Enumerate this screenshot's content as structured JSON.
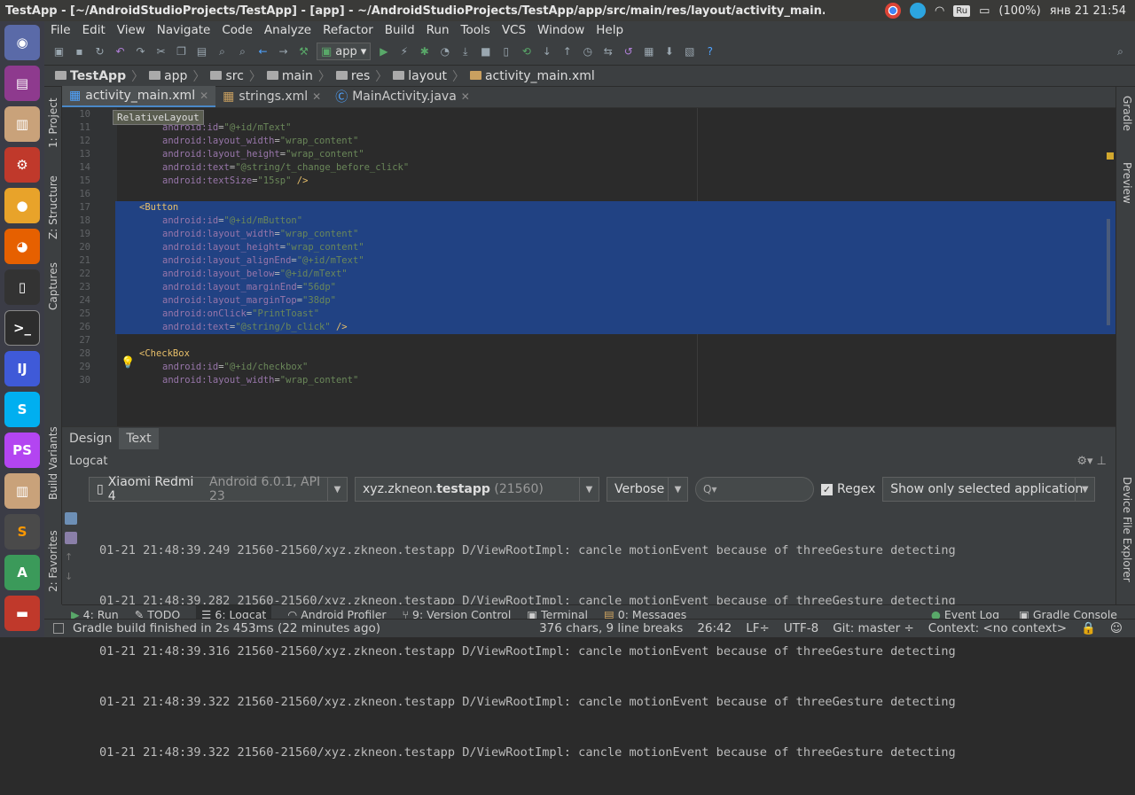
{
  "window_title": "TestApp - [~/AndroidStudioProjects/TestApp] - [app] - ~/AndroidStudioProjects/TestApp/app/src/main/res/layout/activity_main.xml - Ar",
  "tray": {
    "keyboard": "Ru",
    "battery": "(100%)",
    "datetime": "янв 21 21:54"
  },
  "menu": [
    "File",
    "Edit",
    "View",
    "Navigate",
    "Code",
    "Analyze",
    "Refactor",
    "Build",
    "Run",
    "Tools",
    "VCS",
    "Window",
    "Help"
  ],
  "toolbar": {
    "config": "app"
  },
  "breadcrumbs": [
    "TestApp",
    "app",
    "src",
    "main",
    "res",
    "layout",
    "activity_main.xml"
  ],
  "tabs": [
    {
      "label": "activity_main.xml",
      "active": true
    },
    {
      "label": "strings.xml",
      "active": false
    },
    {
      "label": "MainActivity.java",
      "active": false
    }
  ],
  "tooltip": "RelativeLayout",
  "left_tools": [
    "1: Project",
    "Z: Structure",
    "Captures",
    "Build Variants",
    "2: Favorites"
  ],
  "right_tools": [
    "Gradle",
    "Preview",
    "Device File Explorer"
  ],
  "code_lines": [
    {
      "n": "10",
      "tag": "<TextView",
      "sel": false
    },
    {
      "n": "11",
      "attr": "android:id",
      "val": "\"@+id/mText\"",
      "sel": false
    },
    {
      "n": "12",
      "attr": "android:layout_width",
      "val": "\"wrap_content\"",
      "sel": false
    },
    {
      "n": "13",
      "attr": "android:layout_height",
      "val": "\"wrap_content\"",
      "sel": false
    },
    {
      "n": "14",
      "attr": "android:text",
      "val": "\"@string/t_change_before_click\"",
      "sel": false
    },
    {
      "n": "15",
      "attr": "android:textSize",
      "val": "\"15sp\"",
      "end": " />",
      "sel": false
    },
    {
      "n": "16",
      "sel": false
    },
    {
      "n": "17",
      "tag": "<Button",
      "sel": true
    },
    {
      "n": "18",
      "attr": "android:id",
      "val": "\"@+id/mButton\"",
      "sel": true
    },
    {
      "n": "19",
      "attr": "android:layout_width",
      "val": "\"wrap_content\"",
      "sel": true
    },
    {
      "n": "20",
      "attr": "android:layout_height",
      "val": "\"wrap_content\"",
      "sel": true
    },
    {
      "n": "21",
      "attr": "android:layout_alignEnd",
      "val": "\"@+id/mText\"",
      "sel": true
    },
    {
      "n": "22",
      "attr": "android:layout_below",
      "val": "\"@+id/mText\"",
      "sel": true
    },
    {
      "n": "23",
      "attr": "android:layout_marginEnd",
      "val": "\"56dp\"",
      "sel": true
    },
    {
      "n": "24",
      "attr": "android:layout_marginTop",
      "val": "\"38dp\"",
      "sel": true
    },
    {
      "n": "25",
      "attr": "android:onClick",
      "val": "\"PrintToast\"",
      "sel": true
    },
    {
      "n": "26",
      "attr": "android:text",
      "val": "\"@string/b_click\"",
      "end": " />",
      "sel": true
    },
    {
      "n": "27",
      "sel": false
    },
    {
      "n": "28",
      "tag": "<CheckBox",
      "sel": false
    },
    {
      "n": "29",
      "attr": "android:id",
      "val": "\"@+id/checkbox\"",
      "sel": false
    },
    {
      "n": "30",
      "attr": "android:layout_width",
      "val": "\"wrap_content\"",
      "sel": false
    }
  ],
  "design_tabs": [
    "Design",
    "Text"
  ],
  "logcat": {
    "title": "Logcat",
    "device": "Xiaomi Redmi 4",
    "device_info": "Android 6.0.1, API 23",
    "process_prefix": "xyz.zkneon.",
    "process_bold": "testapp",
    "process_pid": "(21560)",
    "level": "Verbose",
    "search_placeholder": "Q▾",
    "regex_label": "Regex",
    "filter": "Show only selected application",
    "lines": [
      "01-21 21:48:39.249 21560-21560/xyz.zkneon.testapp D/ViewRootImpl: cancle motionEvent because of threeGesture detecting",
      "01-21 21:48:39.282 21560-21560/xyz.zkneon.testapp D/ViewRootImpl: cancle motionEvent because of threeGesture detecting",
      "01-21 21:48:39.316 21560-21560/xyz.zkneon.testapp D/ViewRootImpl: cancle motionEvent because of threeGesture detecting",
      "01-21 21:48:39.322 21560-21560/xyz.zkneon.testapp D/ViewRootImpl: cancle motionEvent because of threeGesture detecting",
      "01-21 21:48:39.322 21560-21560/xyz.zkneon.testapp D/ViewRootImpl: cancle motionEvent because of threeGesture detecting"
    ]
  },
  "bottom_tools": [
    "4: Run",
    "TODO",
    "6: Logcat",
    "Android Profiler",
    "9: Version Control",
    "Terminal",
    "0: Messages"
  ],
  "bottom_right_tools": [
    "Event Log",
    "Gradle Console"
  ],
  "status": {
    "message": "Gradle build finished in 2s 453ms (22 minutes ago)",
    "chars": "376 chars, 9 line breaks",
    "position": "26:42",
    "line_sep": "LF÷",
    "encoding": "UTF-8",
    "git": "Git: master ÷",
    "context": "Context: <no context>"
  }
}
